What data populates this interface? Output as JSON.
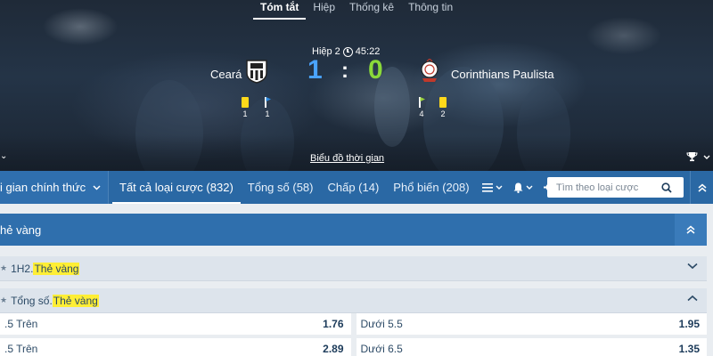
{
  "header": {
    "tabs": [
      {
        "label": "Tóm tắt",
        "active": true
      },
      {
        "label": "Hiệp",
        "active": false
      },
      {
        "label": "Thống kê",
        "active": false
      },
      {
        "label": "Thông tin",
        "active": false
      }
    ],
    "period_label": "Hiệp 2",
    "clock": "45:22",
    "home_team": "Ceará",
    "away_team": "Corinthians Paulista",
    "home_score": "1",
    "score_separator": ":",
    "away_score": "0",
    "home_yellow_cards": "1",
    "home_corners": "1",
    "away_corners": "4",
    "away_yellow_cards": "2",
    "timeline_link": "Biểu đồ thời gian",
    "colors": {
      "home_score": "#4aa3ff",
      "away_score": "#8ad93a",
      "yellow_card": "#ffd91a"
    }
  },
  "nav": {
    "first_label": "i gian chính thức",
    "items": [
      {
        "label": "Tất cả loại cược (832)",
        "active": true
      },
      {
        "label": "Tổng số (58)",
        "active": false
      },
      {
        "label": "Chấp (14)",
        "active": false
      },
      {
        "label": "Phổ biến (208)",
        "active": false
      }
    ],
    "search_placeholder": "Tìm theo loại cược",
    "bar_color": "#2a68a4"
  },
  "section": {
    "title": "hẻ vàng"
  },
  "groups": [
    {
      "prefix": "1H2. ",
      "highlight": "Thẻ vàng",
      "expanded": false
    },
    {
      "prefix": "Tổng số. ",
      "highlight": "Thẻ vàng",
      "expanded": true
    }
  ],
  "odds": [
    {
      "left_label": ".5 Trên",
      "left_value": "1.76",
      "right_label": "Dưới 5.5",
      "right_value": "1.95"
    },
    {
      "left_label": ".5 Trên",
      "left_value": "2.89",
      "right_label": "Dưới 6.5",
      "right_value": "1.35"
    }
  ]
}
